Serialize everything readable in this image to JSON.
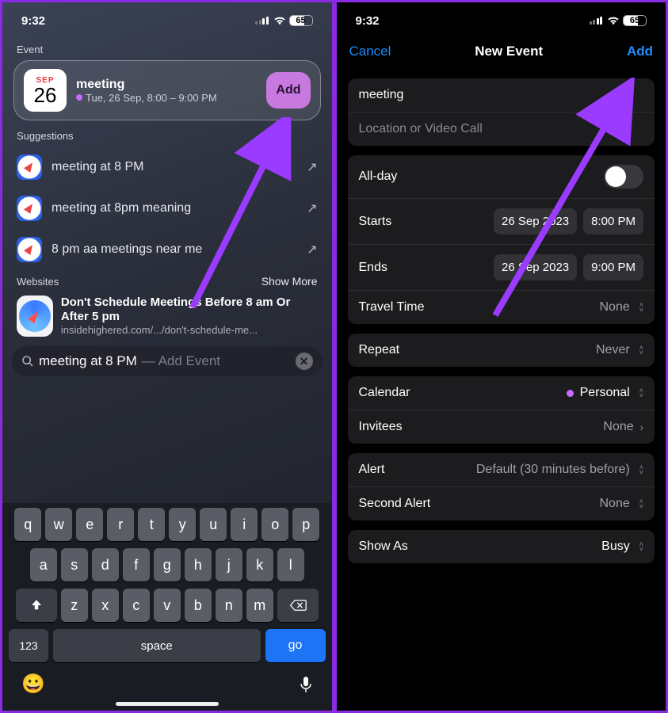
{
  "status": {
    "time": "9:32",
    "battery": "65"
  },
  "left": {
    "section_event": "Event",
    "event": {
      "month": "SEP",
      "day": "26",
      "title": "meeting",
      "subtitle": "Tue, 26 Sep, 8:00 – 9:00 PM",
      "add": "Add"
    },
    "suggestions_label": "Suggestions",
    "suggestions": [
      "meeting at 8 PM",
      "meeting at 8pm meaning",
      "8 pm aa meetings near me"
    ],
    "websites_label": "Websites",
    "show_more": "Show More",
    "website": {
      "title": "Don't Schedule Meetings Before 8 am Or After 5 pm",
      "url": "insidehighered.com/.../don't-schedule-me..."
    },
    "search": {
      "query": "meeting at 8 PM",
      "hint": " — Add Event"
    },
    "keyboard": {
      "row1": [
        "q",
        "w",
        "e",
        "r",
        "t",
        "y",
        "u",
        "i",
        "o",
        "p"
      ],
      "row2": [
        "a",
        "s",
        "d",
        "f",
        "g",
        "h",
        "j",
        "k",
        "l"
      ],
      "row3": [
        "z",
        "x",
        "c",
        "v",
        "b",
        "n",
        "m"
      ],
      "sym": "123",
      "space": "space",
      "go": "go"
    }
  },
  "right": {
    "cancel": "Cancel",
    "title": "New Event",
    "add": "Add",
    "title_field": "meeting",
    "location_placeholder": "Location or Video Call",
    "allday_label": "All-day",
    "starts_label": "Starts",
    "starts_date": "26 Sep 2023",
    "starts_time": "8:00 PM",
    "ends_label": "Ends",
    "ends_date": "26 Sep 2023",
    "ends_time": "9:00 PM",
    "travel_label": "Travel Time",
    "travel_value": "None",
    "repeat_label": "Repeat",
    "repeat_value": "Never",
    "calendar_label": "Calendar",
    "calendar_value": "Personal",
    "invitees_label": "Invitees",
    "invitees_value": "None",
    "alert_label": "Alert",
    "alert_value": "Default (30 minutes before)",
    "second_alert_label": "Second Alert",
    "second_alert_value": "None",
    "showas_label": "Show As",
    "showas_value": "Busy"
  }
}
